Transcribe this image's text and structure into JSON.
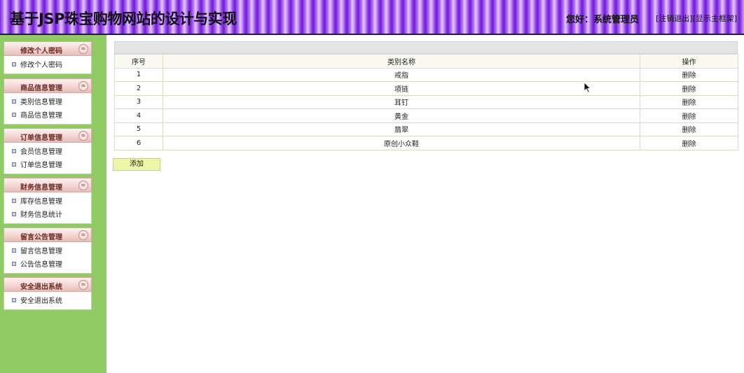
{
  "header": {
    "title": "基于JSP珠宝购物网站的设计与实现",
    "greeting": "您好：系统管理员",
    "logout_link": "注销退出",
    "frame_link": "显示主框架"
  },
  "sidebar": {
    "groups": [
      {
        "title": "修改个人密码",
        "items": [
          "修改个人密码"
        ]
      },
      {
        "title": "商品信息管理",
        "items": [
          "类别信息管理",
          "商品信息管理"
        ]
      },
      {
        "title": "订单信息管理",
        "items": [
          "会员信息管理",
          "订单信息管理"
        ]
      },
      {
        "title": "财务信息管理",
        "items": [
          "库存信息管理",
          "财务信息统计"
        ]
      },
      {
        "title": "留言公告管理",
        "items": [
          "留言信息管理",
          "公告信息管理"
        ]
      },
      {
        "title": "安全退出系统",
        "items": [
          "安全退出系统"
        ]
      }
    ],
    "toggle_glyph": "≈"
  },
  "table": {
    "headers": [
      "序号",
      "类别名称",
      "操作"
    ],
    "rows": [
      {
        "id": "1",
        "name": "戒指",
        "action": "删除"
      },
      {
        "id": "2",
        "name": "项链",
        "action": "删除"
      },
      {
        "id": "3",
        "name": "耳钉",
        "action": "删除"
      },
      {
        "id": "4",
        "name": "黄金",
        "action": "删除"
      },
      {
        "id": "5",
        "name": "翡翠",
        "action": "删除"
      },
      {
        "id": "6",
        "name": "原创小众鞋",
        "action": "删除"
      }
    ]
  },
  "add_button": "添加",
  "colors": {
    "sidebar_bg": "#8fcb62",
    "header_purple": "#8a3ae0",
    "add_button_bg": "#eef7a8"
  }
}
